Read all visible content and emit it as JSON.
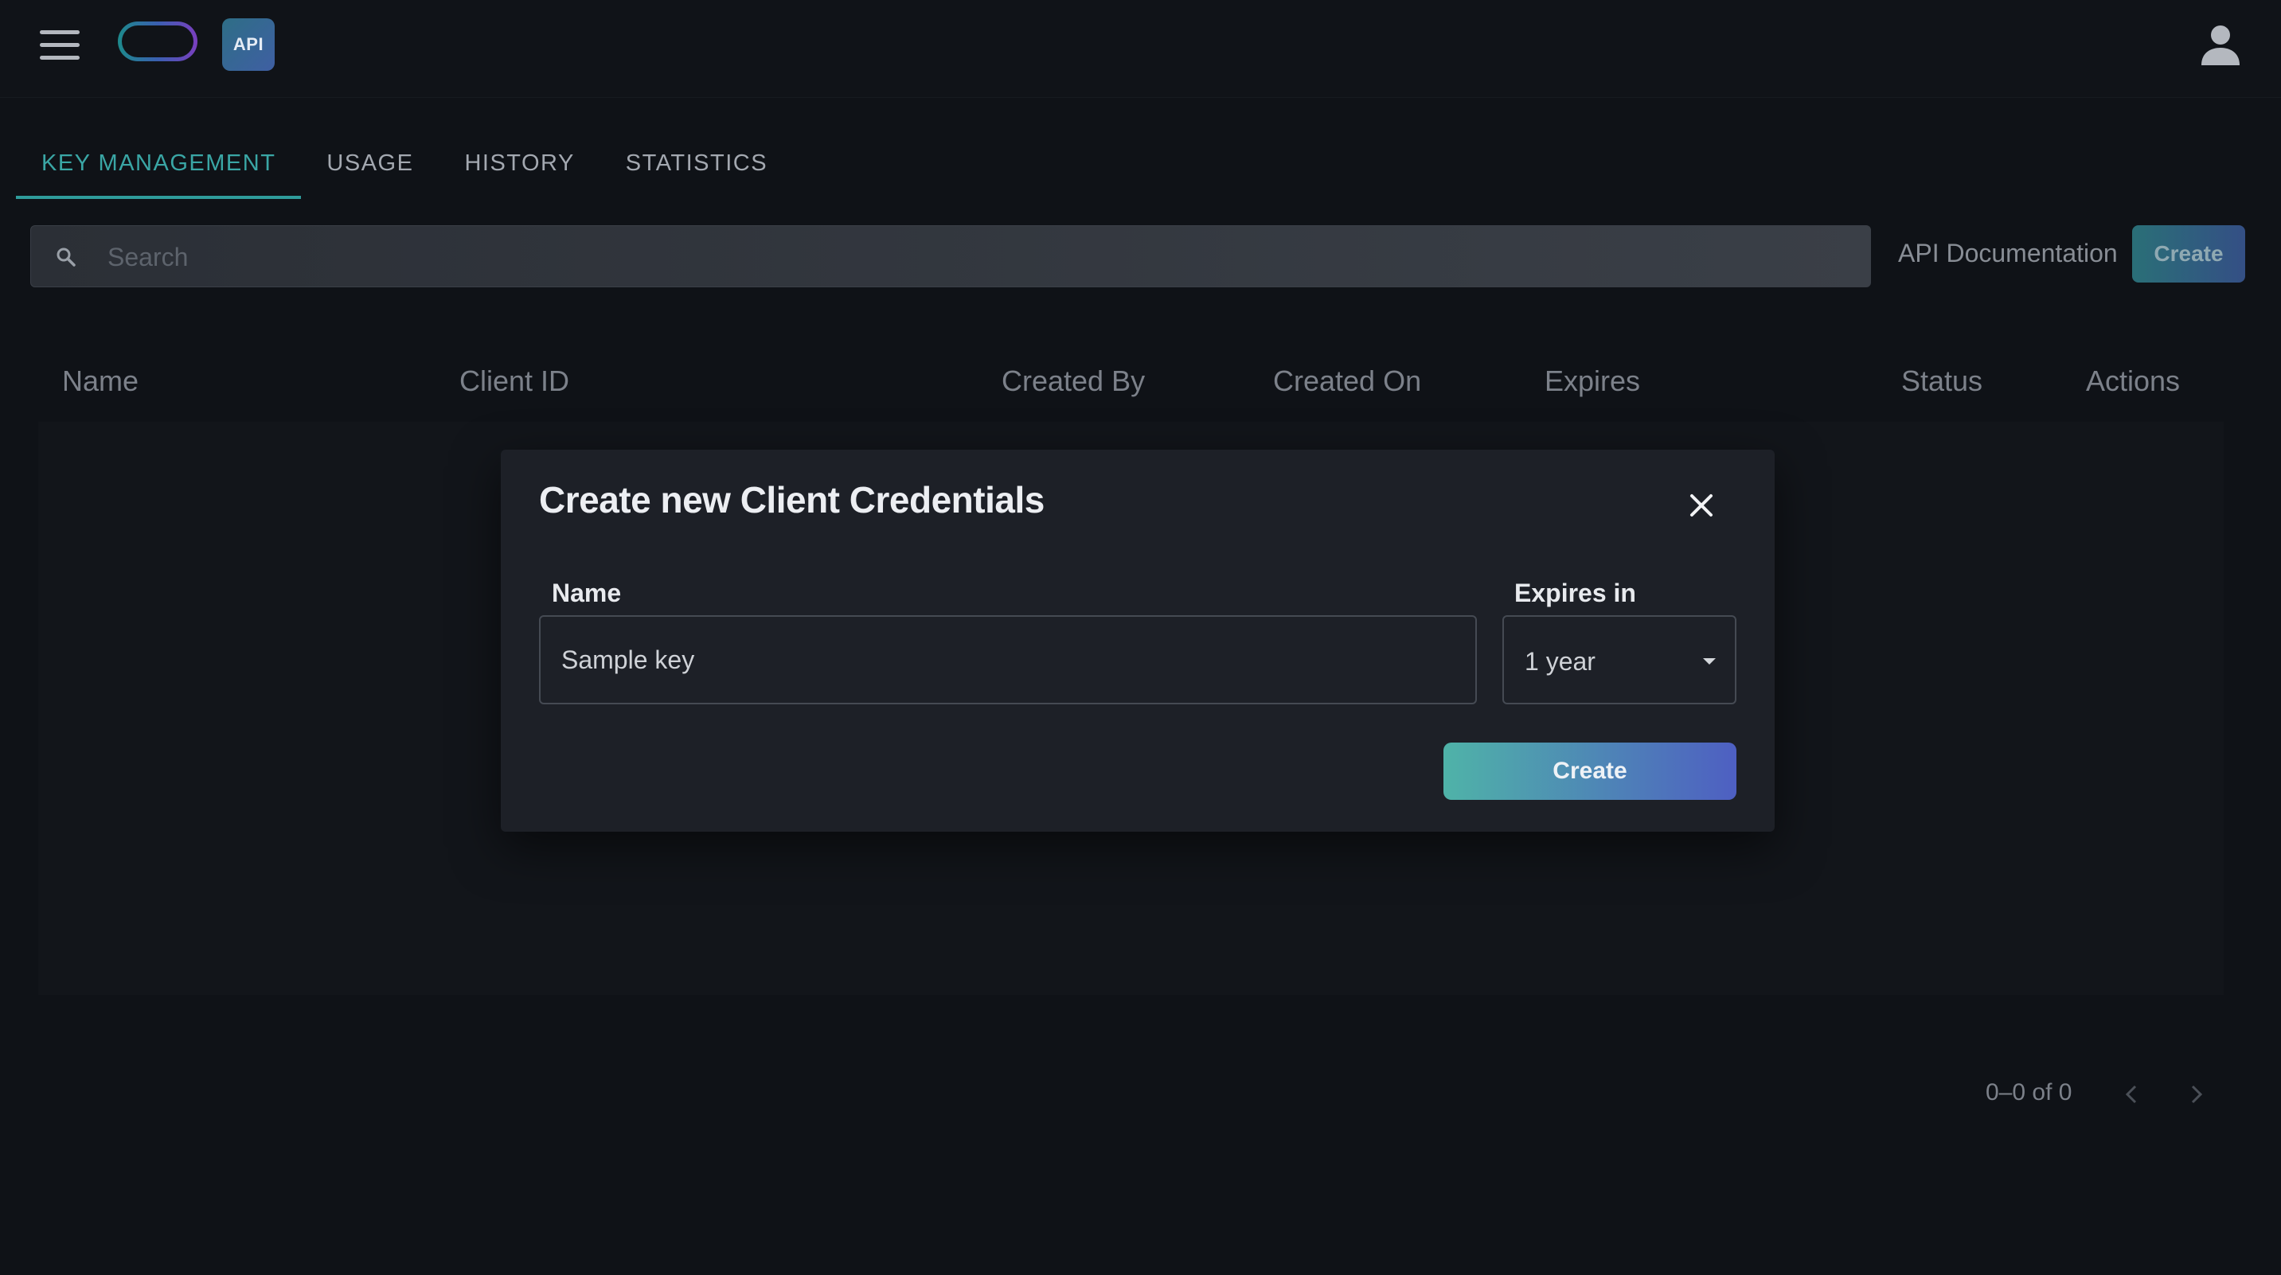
{
  "header": {
    "menu_icon": "hamburger-menu-icon",
    "logo_icon": "pill-logo-icon",
    "badge_text": "API",
    "user_icon": "user-avatar-icon"
  },
  "tabs": [
    {
      "label": "KEY MANAGEMENT",
      "active": true
    },
    {
      "label": "USAGE",
      "active": false
    },
    {
      "label": "HISTORY",
      "active": false
    },
    {
      "label": "STATISTICS",
      "active": false
    }
  ],
  "toolbar": {
    "search_placeholder": "Search",
    "search_value": "",
    "docs_link": "API Documentation",
    "create_label": "Create"
  },
  "table": {
    "columns": [
      "Name",
      "Client ID",
      "Created By",
      "Created On",
      "Expires",
      "Status",
      "Actions"
    ],
    "rows": []
  },
  "pagination": {
    "range_text": "0–0 of 0"
  },
  "modal": {
    "title": "Create new Client Credentials",
    "name_label": "Name",
    "name_value": "Sample key",
    "expires_label": "Expires in",
    "expires_value": "1 year",
    "create_label": "Create"
  },
  "colors": {
    "accent": "#2f9c9b",
    "background": "#0f1217",
    "modal_background": "#1d2027"
  }
}
